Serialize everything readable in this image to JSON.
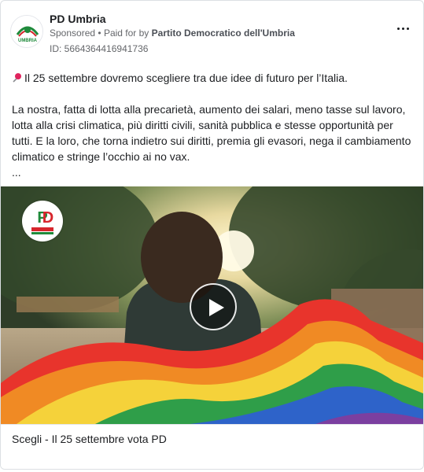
{
  "advertiser": {
    "page_name": "PD Umbria",
    "sponsored_label": "Sponsored",
    "separator": "•",
    "paid_for_prefix": "Paid for by",
    "paid_for_by": "Partito Democratico dell'Umbria",
    "ad_id": "ID: 5664364416941736",
    "logo_text_top": "PD",
    "logo_text_bottom": "UMBRIA"
  },
  "post": {
    "pin_icon": "pushpin-icon",
    "line1": "Il 25 settembre dovremo scegliere tra due idee di futuro per l’Italia.",
    "paragraph2": "La nostra, fatta di lotta alla precarietà, aumento dei salari, meno tasse sul lavoro, lotta alla crisi climatica, più diritti civili, sanità pubblica e stesse opportunità per tutti. E la loro, che torna indietro sui diritti, premia gli evasori, nega il cambiamento climatico e stringe l’occhio ai no vax.",
    "ellipsis": "..."
  },
  "media": {
    "type": "video",
    "play_icon": "play-icon",
    "logo_caption": "PD"
  },
  "footer": {
    "headline": "Scegli - Il 25 settembre vota PD"
  },
  "colors": {
    "pd_green": "#1f8a3b",
    "pd_red": "#d7262c",
    "text": "#1c1e21",
    "muted": "#65676b"
  }
}
